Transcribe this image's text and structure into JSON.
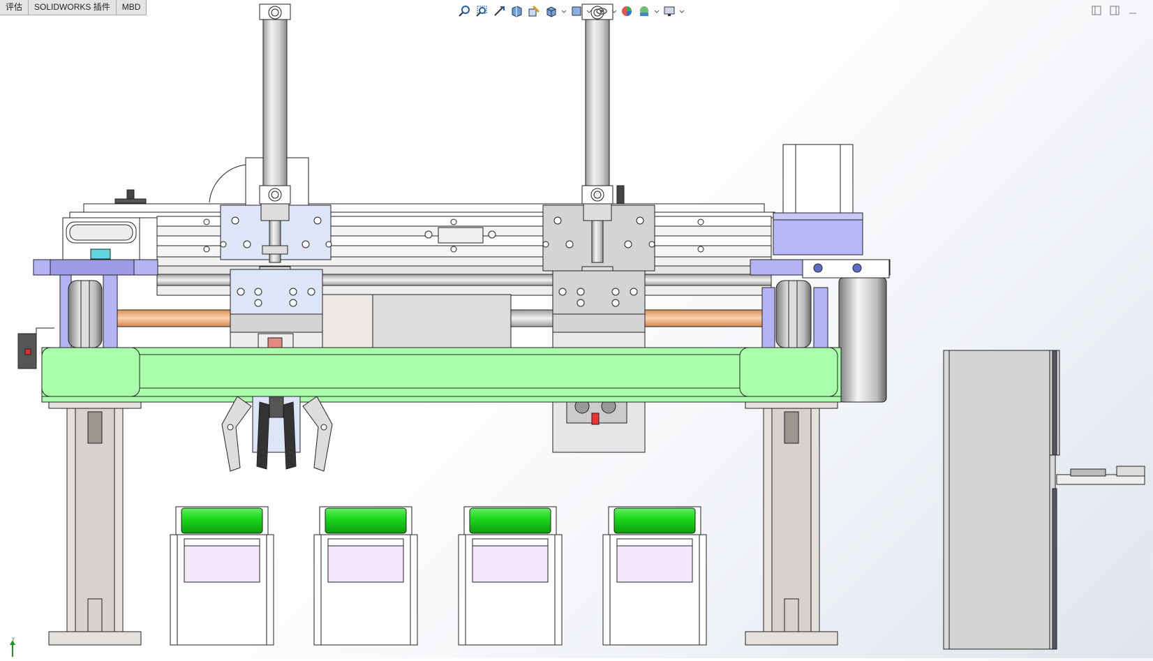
{
  "command_manager": {
    "tabs": [
      "评估",
      "SOLIDWORKS 插件",
      "MBD"
    ]
  },
  "heads_up_toolbar": {
    "buttons": [
      {
        "name": "zoom-to-fit-icon"
      },
      {
        "name": "zoom-to-area-icon"
      },
      {
        "name": "previous-view-icon"
      },
      {
        "name": "section-view-icon"
      },
      {
        "name": "dynamic-annotation-icon"
      },
      {
        "name": "view-orientation-icon",
        "dropdown": true
      },
      {
        "name": "display-style-icon",
        "dropdown": true
      },
      {
        "name": "hide-show-items-icon",
        "dropdown": true
      },
      {
        "name": "edit-appearance-icon"
      },
      {
        "name": "apply-scene-icon",
        "dropdown": true
      },
      {
        "name": "view-settings-icon",
        "dropdown": true
      }
    ]
  },
  "window_controls": [
    "restore-left-icon",
    "restore-right-icon",
    "minimize-icon"
  ],
  "model_colors": {
    "beam": "#aaffaa",
    "bracket": "#b4b4f4",
    "carriage": "#dde6f6",
    "carriage_dark": "#d4d4d4",
    "shaft": "#e8a878",
    "roller": "#11cc11",
    "pad": "#f6e6fa",
    "steel": "#c8c8c8"
  },
  "triad": {
    "axis_label": "Y"
  }
}
